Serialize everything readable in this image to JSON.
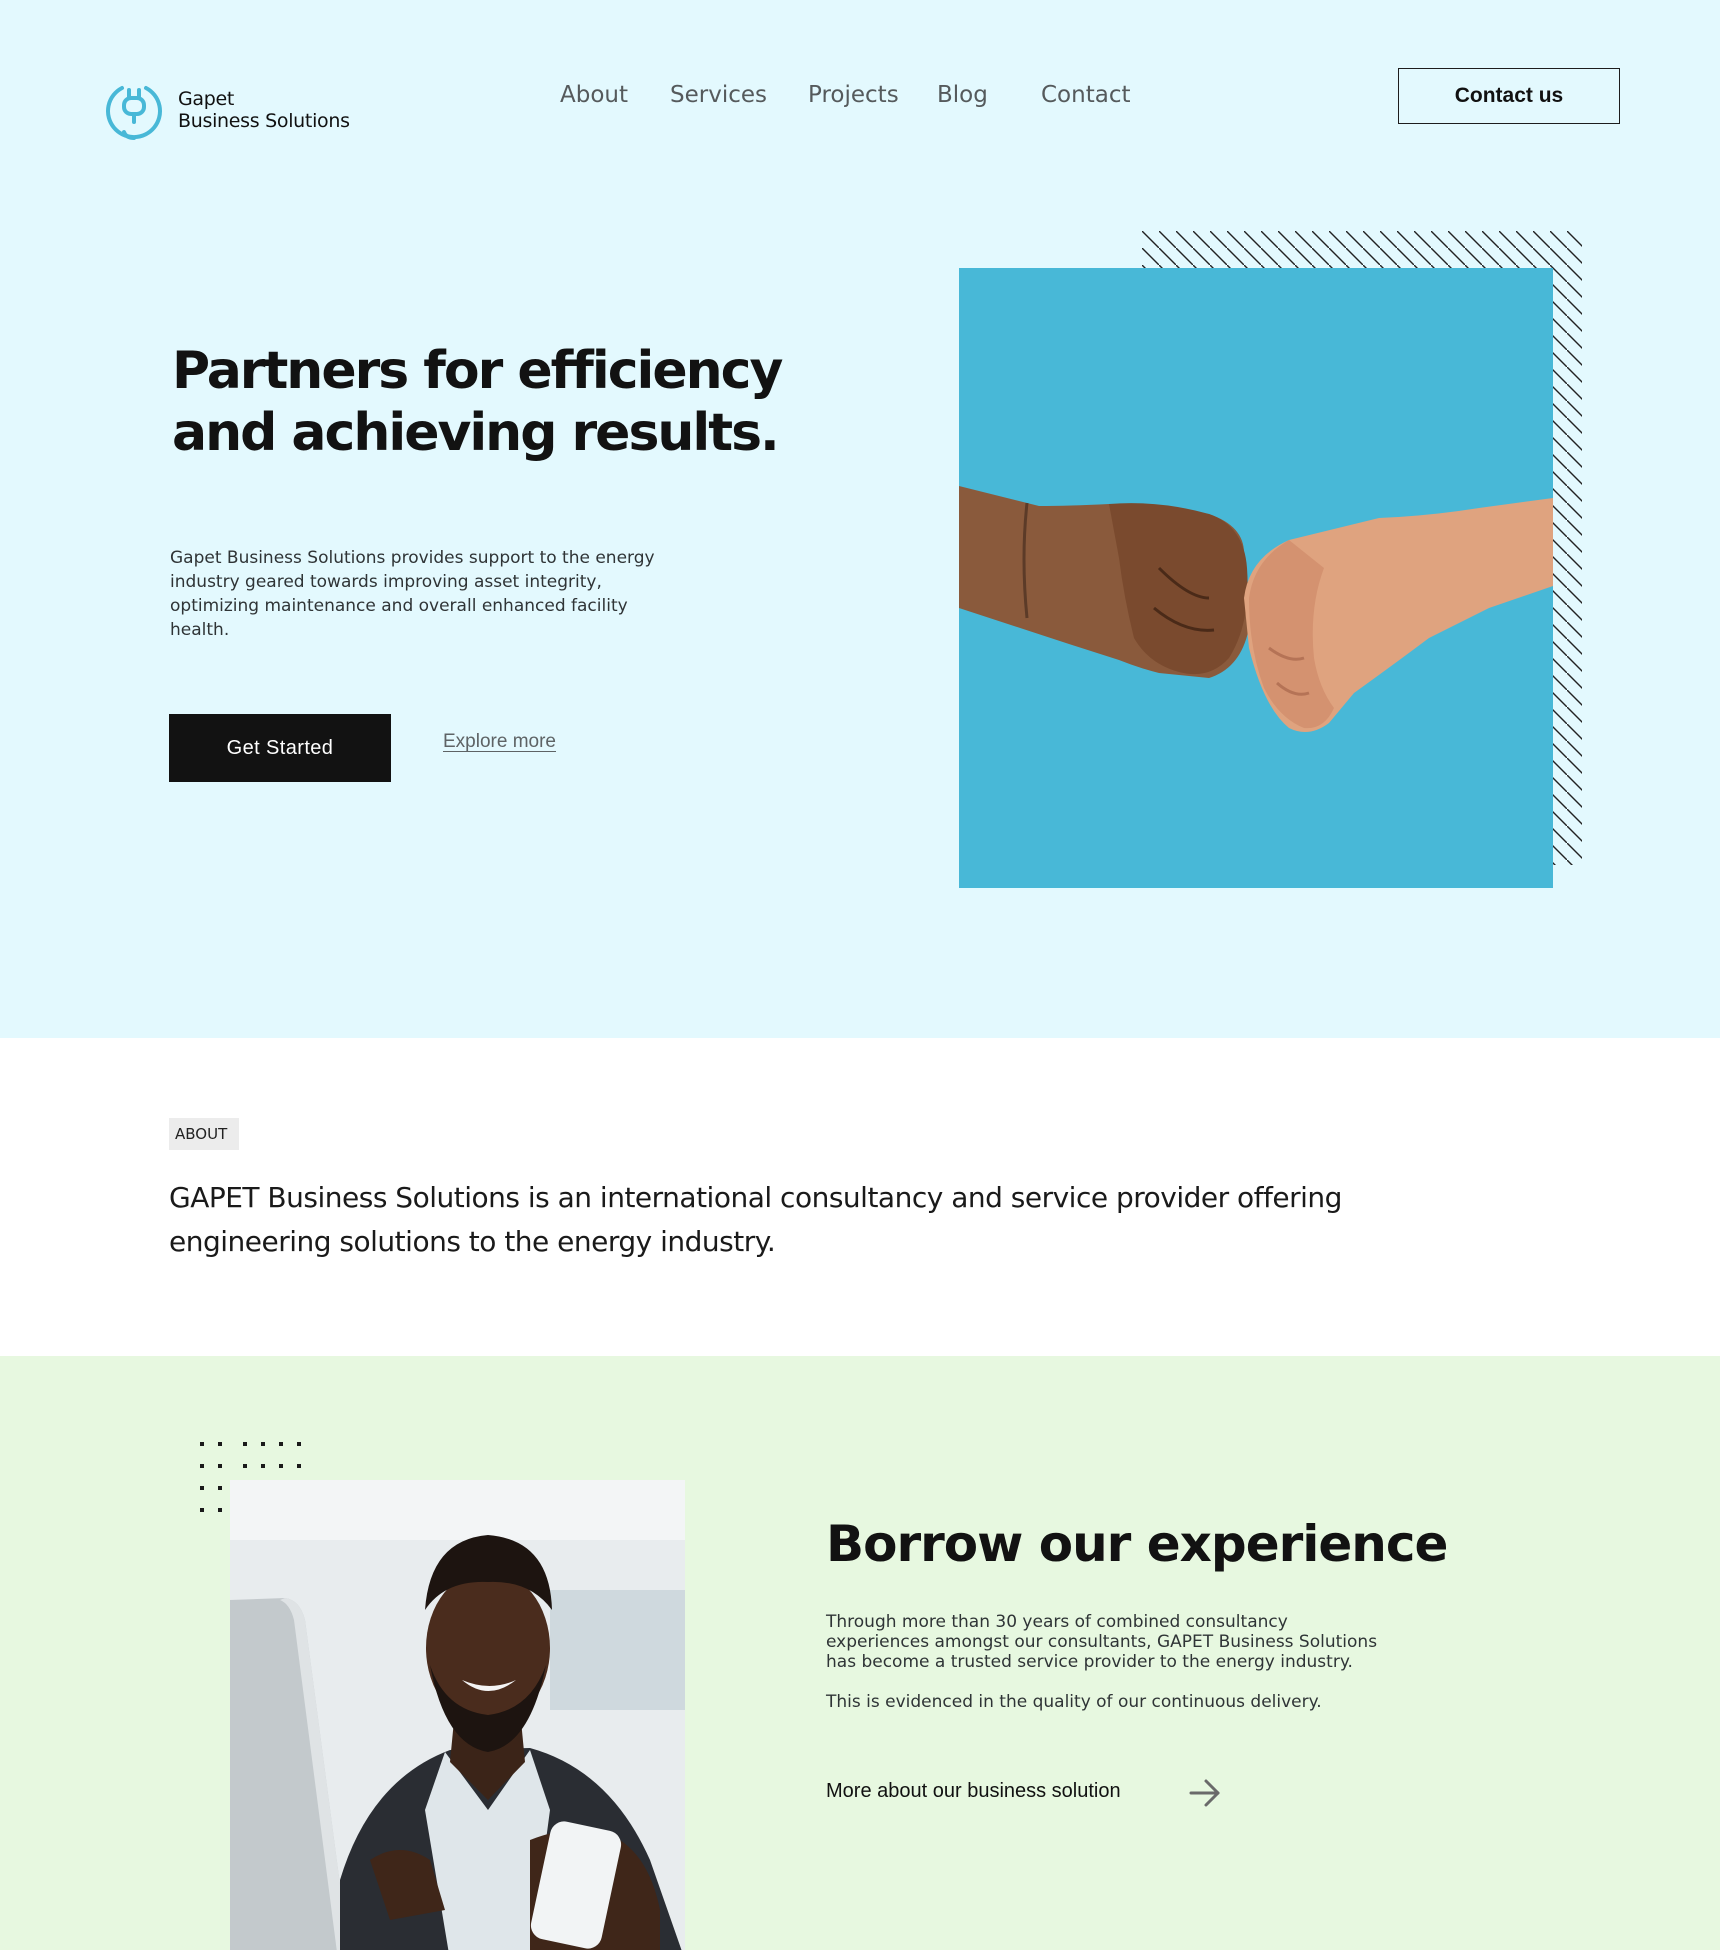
{
  "brand": {
    "line1": "Gapet",
    "line2": "Business Solutions",
    "accent_color": "#48b8d7"
  },
  "nav": {
    "items": [
      "About",
      "Services",
      "Projects",
      "Blog",
      "Contact"
    ],
    "cta_label": "Contact us"
  },
  "hero": {
    "title_line1": "Partners for efficiency",
    "title_line2": "and achieving results.",
    "description": "Gapet Business Solutions provides support to the energy industry geared towards improving asset integrity, optimizing maintenance and overall enhanced facility health.",
    "primary_button": "Get Started",
    "secondary_link": "Explore more",
    "background_color": "#e3f9fe",
    "image": "fist-bump-photo"
  },
  "about": {
    "tag": "ABOUT",
    "text": "GAPET Business Solutions is an international consultancy and service provider offering engineering solutions to the energy industry."
  },
  "experience": {
    "title": "Borrow our experience",
    "paragraph1": "Through more than 30 years of combined consultancy experiences amongst our consultants, GAPET Business Solutions has become a trusted service provider to the energy industry.",
    "paragraph2": "This is evidenced in the quality of our continuous delivery.",
    "link_label": "More about our business solution",
    "link_icon": "arrow-right-icon",
    "background_color": "#e7f8e0",
    "image": "businessman-with-phone-photo"
  }
}
